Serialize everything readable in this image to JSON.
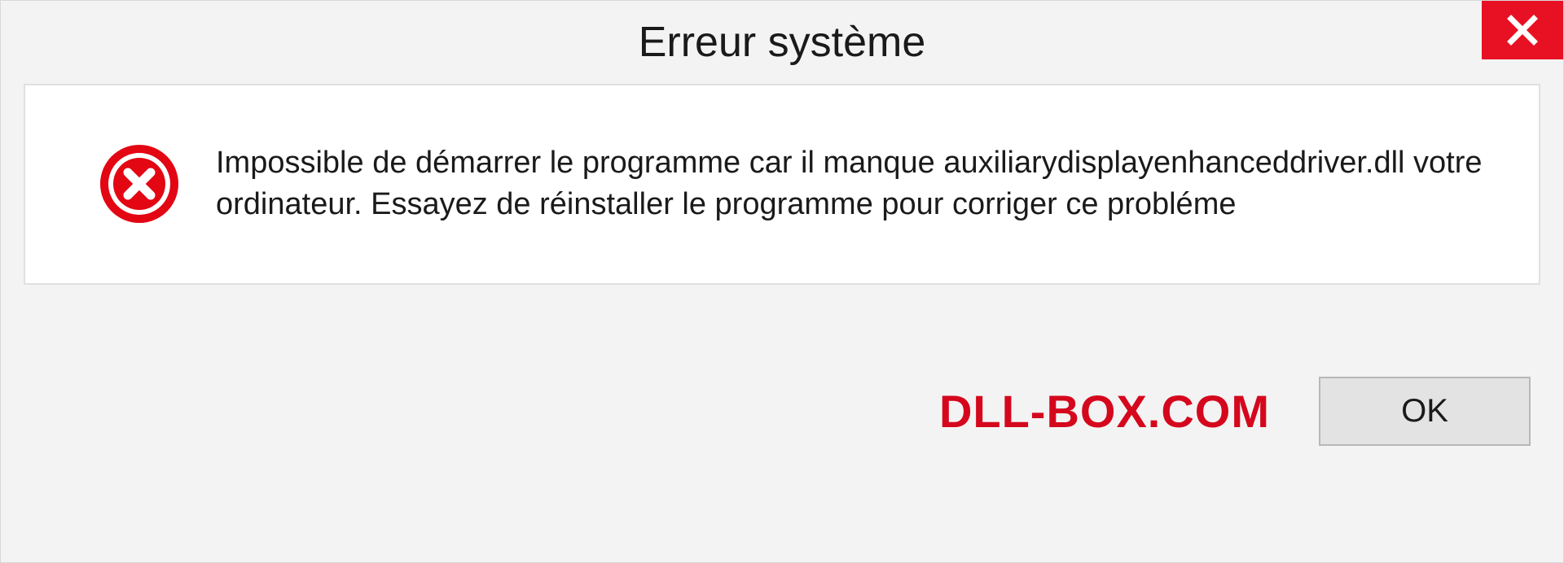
{
  "dialog": {
    "title": "Erreur système",
    "message": "Impossible de démarrer le programme car il manque auxiliarydisplayenhanceddriver.dll votre ordinateur. Essayez de réinstaller le programme pour corriger ce probléme",
    "ok_label": "OK",
    "brand": "DLL-BOX.COM"
  },
  "colors": {
    "close_bg": "#e81123",
    "error_icon": "#e30613",
    "brand": "#d5071d"
  }
}
